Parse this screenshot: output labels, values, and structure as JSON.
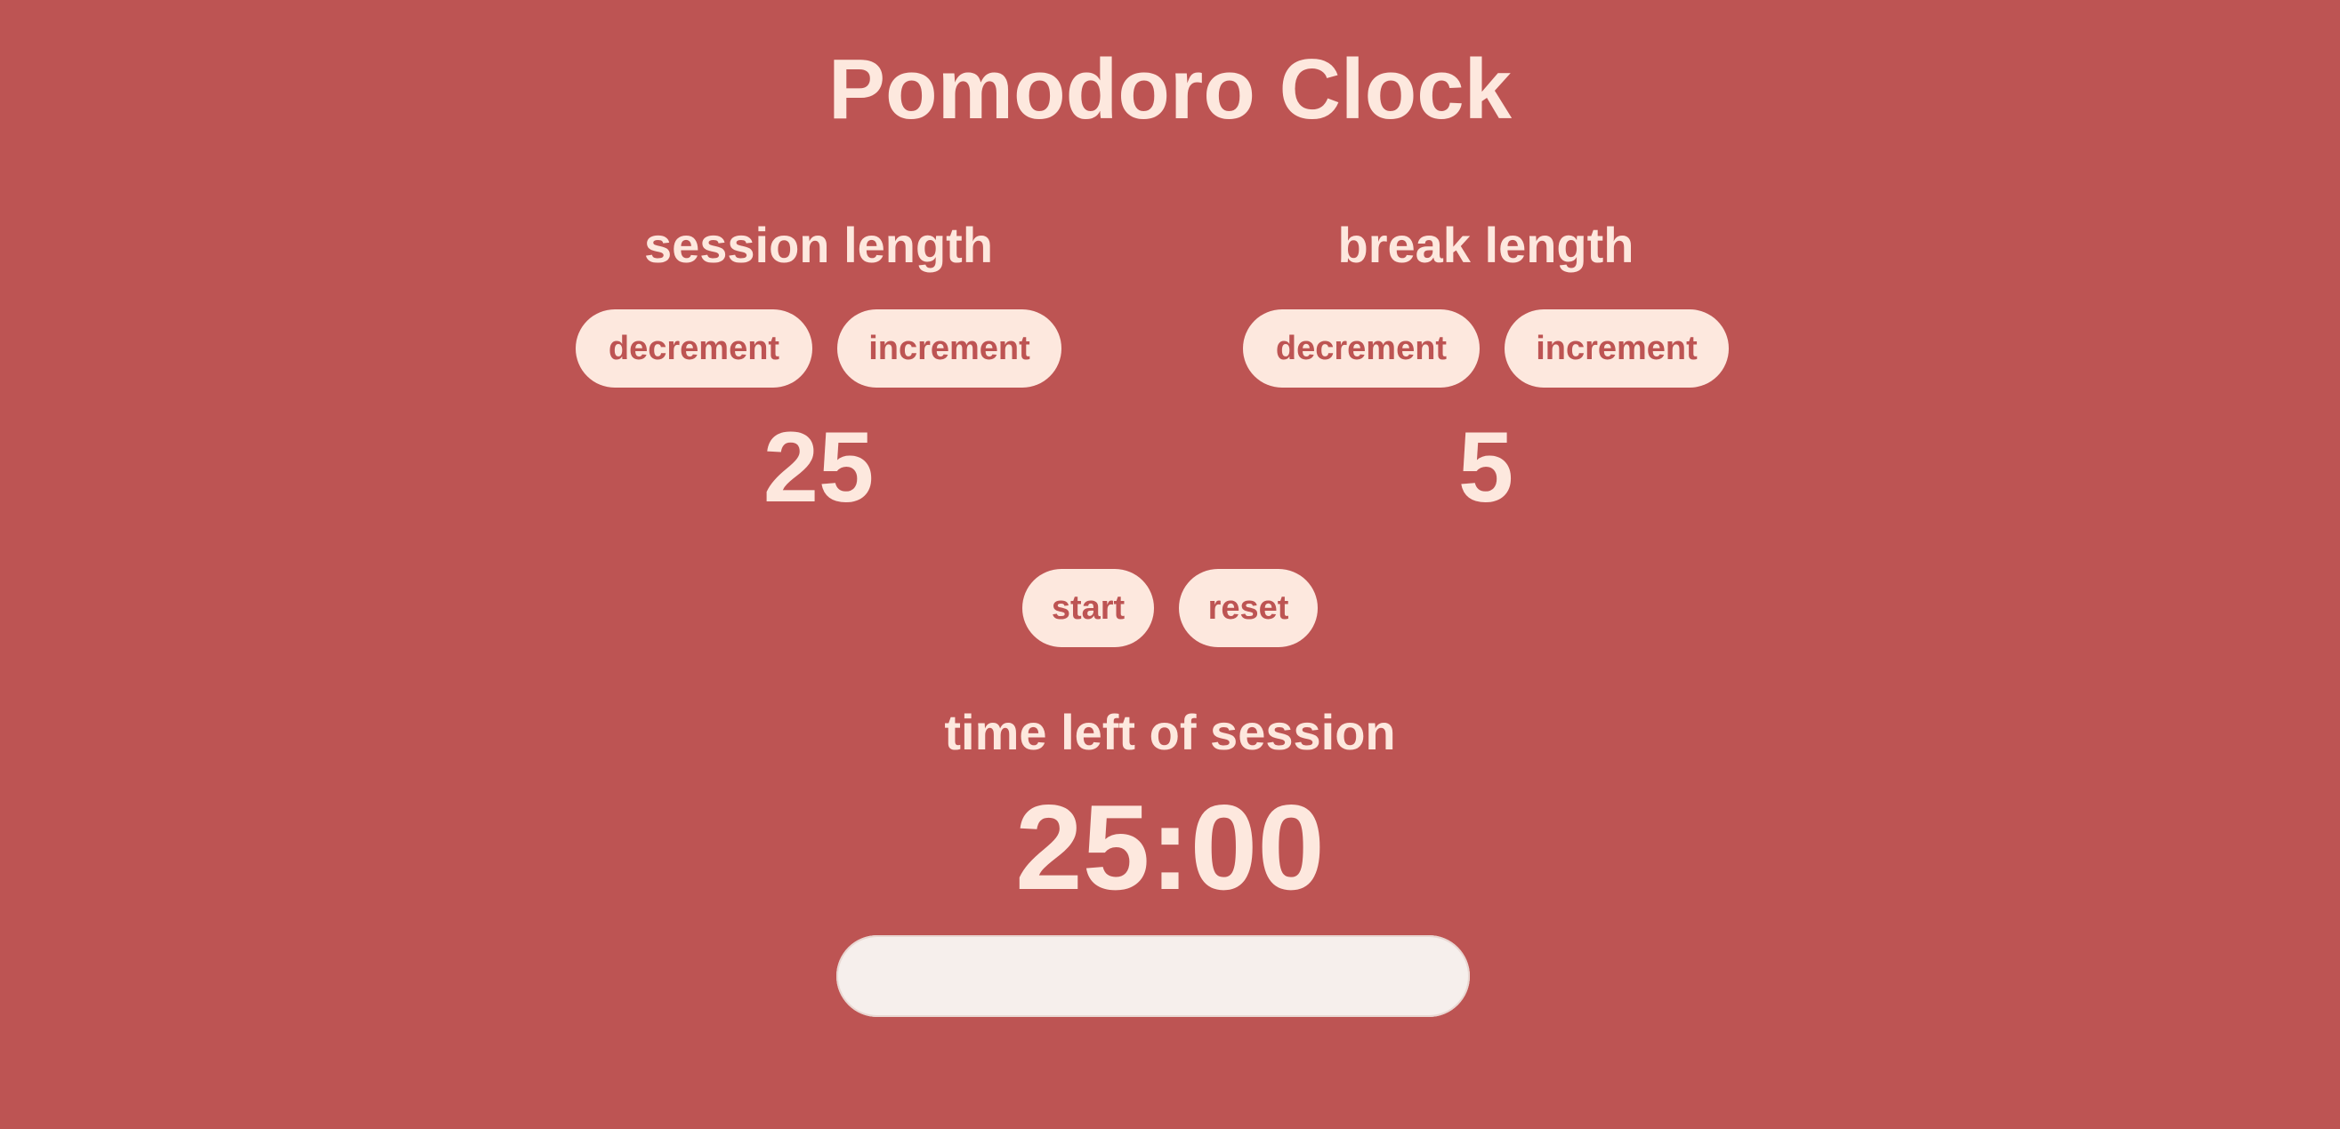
{
  "app": {
    "title": "Pomodoro Clock"
  },
  "session": {
    "heading": "session length",
    "decrement_label": "decrement",
    "increment_label": "increment",
    "value": "25"
  },
  "break": {
    "heading": "break length",
    "decrement_label": "decrement",
    "increment_label": "increment",
    "value": "5"
  },
  "controls": {
    "start_label": "start",
    "reset_label": "reset"
  },
  "timer": {
    "label": "time left of session",
    "time_left": "25:00",
    "progress": 0
  },
  "colors": {
    "background": "#bd5453",
    "foreground": "#fde8de",
    "progress_track": "#f6efec"
  }
}
